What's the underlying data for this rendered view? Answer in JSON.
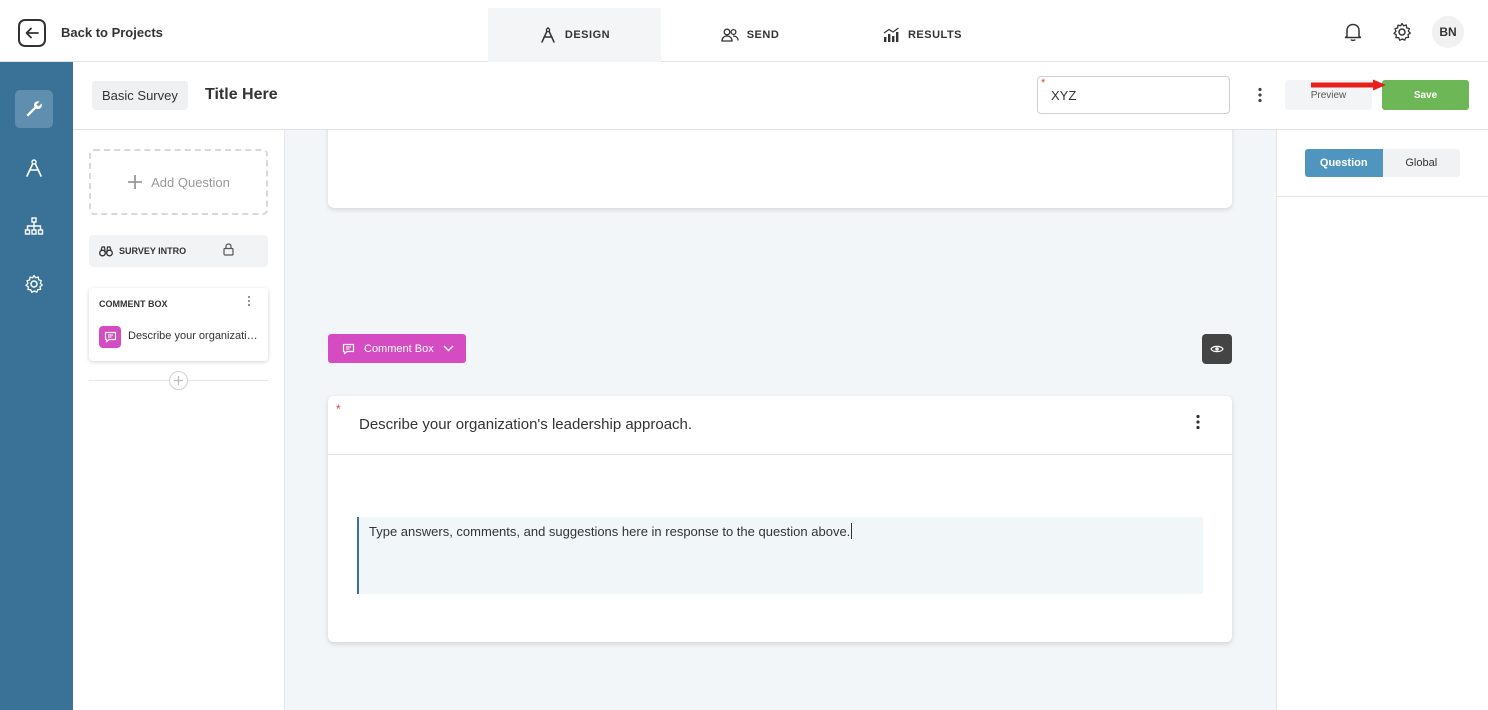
{
  "topbar": {
    "back_label": "Back to Projects",
    "tabs": [
      {
        "label": "DESIGN",
        "icon": "compass-icon",
        "active": true
      },
      {
        "label": "SEND",
        "icon": "users-icon",
        "active": false
      },
      {
        "label": "RESULTS",
        "icon": "chart-icon",
        "active": false
      }
    ],
    "user_initials": "BN"
  },
  "rail": {
    "items": [
      "wrench-icon",
      "compass-icon",
      "sitemap-icon",
      "gear-icon"
    ],
    "active_index": 0
  },
  "subheader": {
    "survey_type": "Basic Survey",
    "survey_title": "Title Here",
    "name_value": "XYZ",
    "preview_label": "Preview",
    "save_label": "Save"
  },
  "outline": {
    "add_question_label": "Add Question",
    "survey_intro_label": "SURVEY INTRO",
    "question_card": {
      "type_label": "COMMENT BOX",
      "question_text": "Describe your organization's leadership approach."
    }
  },
  "canvas": {
    "type_pill_label": "Comment Box",
    "question": {
      "required_mark": "*",
      "text": "Describe your organization's leadership approach.",
      "answer_text": "Type answers, comments, and suggestions here in response to the question above."
    }
  },
  "right_panel": {
    "tabs": [
      {
        "label": "Question",
        "active": true
      },
      {
        "label": "Global",
        "active": false
      }
    ]
  },
  "colors": {
    "rail": "#3a7297",
    "accent_magenta": "#d54cc2",
    "save_green": "#6db757",
    "segment_blue": "#4f95c0",
    "annotation_red": "#e8201b"
  }
}
